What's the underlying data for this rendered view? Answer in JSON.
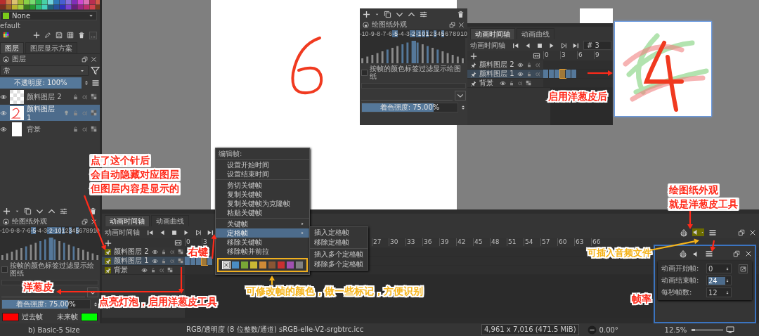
{
  "palette_panel": {
    "dropdown": "None",
    "palette_name": "efault"
  },
  "layers_docker": {
    "tabs": [
      {
        "label": "图层",
        "selected": true
      },
      {
        "label": "图层显示方案",
        "selected": false
      }
    ],
    "title": "图层",
    "blend_mode": "常",
    "opacity": {
      "label": "不透明度:  100%",
      "level": 1
    },
    "layers": [
      {
        "name": "颜料图层 2",
        "kind": "transparent",
        "selected": false,
        "onion_skin": false
      },
      {
        "name": "颜料图层 1",
        "kind": "sketch",
        "selected": true,
        "onion_skin": true
      },
      {
        "name": "背景",
        "kind": "white",
        "selected": false,
        "onion_skin": false
      }
    ]
  },
  "inset": {
    "onion_skin_docker": {
      "title": "绘图纸外观",
      "frames": [
        {
          "label": "-10",
          "on": false
        },
        {
          "label": "-9",
          "on": false
        },
        {
          "label": "-8",
          "on": false
        },
        {
          "label": "-7",
          "on": false
        },
        {
          "label": "-6",
          "on": false
        },
        {
          "label": "-5",
          "on": true
        },
        {
          "label": "-4",
          "on": false
        },
        {
          "label": "-3",
          "on": false
        },
        {
          "label": "-2",
          "on": true
        },
        {
          "label": "-1",
          "on": true
        },
        {
          "label": "0",
          "on": true
        },
        {
          "label": "1",
          "on": true
        },
        {
          "label": "2",
          "on": false
        },
        {
          "label": "3",
          "on": true
        },
        {
          "label": "4",
          "on": false
        },
        {
          "label": "5",
          "on": true
        },
        {
          "label": "6",
          "on": false
        },
        {
          "label": "7",
          "on": false
        },
        {
          "label": "8",
          "on": false
        },
        {
          "label": "9",
          "on": false
        },
        {
          "label": "10",
          "on": false
        }
      ],
      "filter_label": "按帧的颜色标签过滤显示绘图纸",
      "filter_checked": false,
      "tint": {
        "label": "着色强度:  75.00%",
        "level": 0.75
      }
    },
    "timeline": {
      "tabs": [
        {
          "label": "动画时间轴",
          "selected": true
        },
        {
          "label": "动画曲线",
          "selected": false
        }
      ],
      "title": "动画时间轴",
      "frame_field": "# 3",
      "ruler_start": [
        "0",
        "3",
        "6",
        "9"
      ],
      "layers": [
        {
          "name": "颜料图层 2",
          "onion_skin": false,
          "selected": false
        },
        {
          "name": "颜料图层 1",
          "onion_skin": true,
          "selected": true,
          "keyframes": [
            {
              "filled": true,
              "current": false
            },
            {
              "filled": true,
              "current": false
            },
            {
              "filled": true,
              "current": false
            },
            {
              "filled": true,
              "current": true
            },
            {
              "filled": true,
              "current": false
            },
            {
              "filled": true,
              "current": false
            }
          ]
        },
        {
          "name": "背景",
          "onion_skin": false,
          "selected": false
        }
      ]
    }
  },
  "onion_skin_docker": {
    "title": "绘图纸外观",
    "frames": [
      {
        "label": "-10",
        "on": false
      },
      {
        "label": "-9",
        "on": false
      },
      {
        "label": "-8",
        "on": false
      },
      {
        "label": "-7",
        "on": false
      },
      {
        "label": "-6",
        "on": false
      },
      {
        "label": "-5",
        "on": true
      },
      {
        "label": "-4",
        "on": false
      },
      {
        "label": "-3",
        "on": false
      },
      {
        "label": "-2",
        "on": true
      },
      {
        "label": "-1",
        "on": true
      },
      {
        "label": "0",
        "on": true
      },
      {
        "label": "1",
        "on": true
      },
      {
        "label": "2",
        "on": false
      },
      {
        "label": "3",
        "on": true
      },
      {
        "label": "4",
        "on": false
      },
      {
        "label": "5",
        "on": true
      },
      {
        "label": "6",
        "on": false
      },
      {
        "label": "7",
        "on": false
      },
      {
        "label": "8",
        "on": false
      },
      {
        "label": "9",
        "on": false
      },
      {
        "label": "10",
        "on": false
      }
    ],
    "filter_label": "按帧的颜色标签过滤显示绘图纸",
    "filter_checked": false,
    "tint": {
      "label": "着色强度:  75.00%",
      "level": 0.75
    },
    "past": {
      "label": "过去帧",
      "color": "#ff0000"
    },
    "future": {
      "label": "未来帧",
      "color": "#00ff00"
    }
  },
  "timeline": {
    "tabs": [
      {
        "label": "动画时间轴",
        "selected": true
      },
      {
        "label": "动画曲线",
        "selected": false
      }
    ],
    "title": "动画时间轴",
    "ruler_start": [
      "0",
      "3"
    ],
    "ruler_end": [
      "27",
      "30",
      "33",
      "36",
      "39",
      "42",
      "45",
      "48",
      "51",
      "54",
      "57",
      "60",
      "63",
      "66"
    ],
    "layers": [
      {
        "name": "颜料图层 2",
        "onion_skin": false,
        "selected": false
      },
      {
        "name": "颜料图层 1",
        "onion_skin": true,
        "selected": true,
        "keyframes": [
          {
            "filled": true,
            "current": false
          },
          {
            "filled": true,
            "current": false
          },
          {
            "filled": true,
            "current": false
          },
          {
            "filled": true,
            "current": true
          },
          {
            "filled": true,
            "current": false
          }
        ]
      },
      {
        "name": "背景",
        "onion_skin": false,
        "selected": false
      }
    ]
  },
  "context_menu": {
    "header": "编辑帧:",
    "groups": [
      [
        {
          "label": "设置开始时间",
          "submenu": false,
          "selected": false
        },
        {
          "label": "设置结束时间",
          "submenu": false,
          "selected": false
        }
      ],
      [
        {
          "label": "剪切关键帧",
          "submenu": false,
          "selected": false
        },
        {
          "label": "复制关键帧",
          "submenu": false,
          "selected": false
        },
        {
          "label": "复制关键帧为克隆帧",
          "submenu": false,
          "selected": false
        },
        {
          "label": "粘贴关键帧",
          "submenu": false,
          "selected": false
        }
      ],
      [
        {
          "label": "关键帧",
          "submenu": true,
          "selected": false
        },
        {
          "label": "定格帧",
          "submenu": true,
          "selected": true
        },
        {
          "label": "移除关键帧",
          "submenu": false,
          "selected": false
        },
        {
          "label": "移除帧并前拉",
          "submenu": false,
          "selected": false
        }
      ]
    ],
    "swatches": [
      {
        "kind": "clear",
        "selected": true
      },
      {
        "kind": "color",
        "color": "#4a8cc4",
        "selected": false
      },
      {
        "kind": "color",
        "color": "#78a636",
        "selected": false
      },
      {
        "kind": "color",
        "color": "#c9b834",
        "selected": false
      },
      {
        "kind": "color",
        "color": "#d08a36",
        "selected": false
      },
      {
        "kind": "color",
        "color": "#8a5634",
        "selected": false
      },
      {
        "kind": "color",
        "color": "#c83030",
        "selected": false
      },
      {
        "kind": "color",
        "color": "#a050b0",
        "selected": false
      },
      {
        "kind": "color",
        "color": "#808080",
        "selected": false
      }
    ]
  },
  "submenu": {
    "groups": [
      [
        "插入定格帧",
        "移除定格帧"
      ],
      [
        "插入多个定格帧",
        "移除多个定格帧"
      ]
    ]
  },
  "animation_settings": {
    "fields": [
      {
        "label": "动画开始帧:",
        "value": "0",
        "selected": false
      },
      {
        "label": "动画结束帧:",
        "value": "24",
        "selected": true
      },
      {
        "label": "每秒帧数:",
        "value": "12",
        "selected": false
      }
    ]
  },
  "status_bar": {
    "brush": "b) Basic-5 Size",
    "color_space": "RGB/透明度 (8 位整数/通道)  sRGB-elle-V2-srgbtrc.icc",
    "size": "4,961 x 7,016 (471.5 MiB)",
    "rotation": "0.00°",
    "zoom": "12.5%",
    "zoom_slider": {
      "level": 0.12
    }
  },
  "annotations": [
    {
      "lines": [
        "启用洋葱皮后"
      ],
      "color": "#ff2a1a"
    },
    {
      "lines": [
        "点了这个针后",
        "会自动隐藏对应图层",
        "但图层内容是显示的"
      ],
      "color": "#ff2a1a"
    },
    {
      "lines": [
        "绘图纸外观",
        "就是洋葱皮工具"
      ],
      "color": "#ff2a1a"
    },
    {
      "lines": [
        "右键"
      ],
      "color": "#ff2a1a"
    },
    {
      "lines": [
        "可插入音频文件"
      ],
      "color": "#f5b31a"
    },
    {
      "lines": [
        "洋葱皮"
      ],
      "color": "#ff2a1a"
    },
    {
      "lines": [
        "点亮灯泡，启用洋葱皮工具"
      ],
      "color": "#ff2a1a"
    },
    {
      "lines": [
        "可修改帧的颜色，做一些标记，方便识别"
      ],
      "color": "#f5b31a"
    },
    {
      "lines": [
        "帧率"
      ],
      "color": "#ff2a1a"
    }
  ]
}
